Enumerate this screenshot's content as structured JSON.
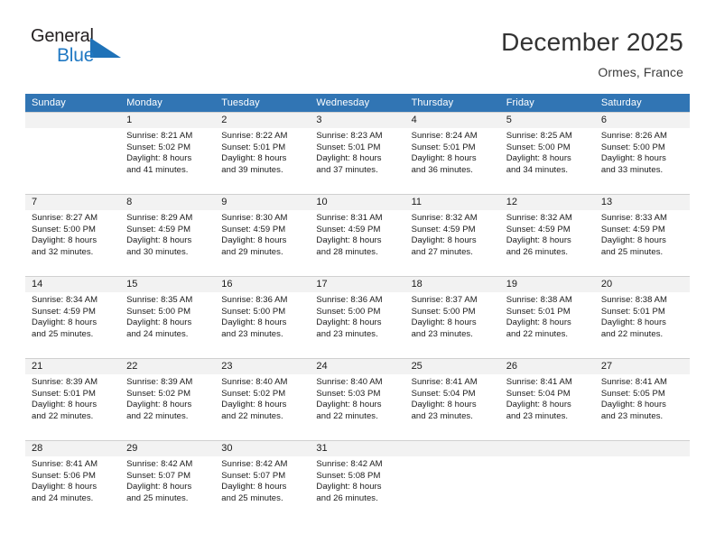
{
  "brand": {
    "name_top": "General",
    "name_bottom": "Blue",
    "triangle_color": "#1f72b8",
    "blue_color": "#2079c3"
  },
  "header": {
    "title": "December 2025",
    "subtitle": "Ormes, France"
  },
  "colors": {
    "header_bar": "#3175b4",
    "daynum_band": "#f2f2f2",
    "grid_line": "#d0d0d0"
  },
  "weekdays": [
    "Sunday",
    "Monday",
    "Tuesday",
    "Wednesday",
    "Thursday",
    "Friday",
    "Saturday"
  ],
  "weeks": [
    [
      {
        "day": "",
        "l1": "",
        "l2": "",
        "l3": "",
        "l4": ""
      },
      {
        "day": "1",
        "l1": "Sunrise: 8:21 AM",
        "l2": "Sunset: 5:02 PM",
        "l3": "Daylight: 8 hours",
        "l4": "and 41 minutes."
      },
      {
        "day": "2",
        "l1": "Sunrise: 8:22 AM",
        "l2": "Sunset: 5:01 PM",
        "l3": "Daylight: 8 hours",
        "l4": "and 39 minutes."
      },
      {
        "day": "3",
        "l1": "Sunrise: 8:23 AM",
        "l2": "Sunset: 5:01 PM",
        "l3": "Daylight: 8 hours",
        "l4": "and 37 minutes."
      },
      {
        "day": "4",
        "l1": "Sunrise: 8:24 AM",
        "l2": "Sunset: 5:01 PM",
        "l3": "Daylight: 8 hours",
        "l4": "and 36 minutes."
      },
      {
        "day": "5",
        "l1": "Sunrise: 8:25 AM",
        "l2": "Sunset: 5:00 PM",
        "l3": "Daylight: 8 hours",
        "l4": "and 34 minutes."
      },
      {
        "day": "6",
        "l1": "Sunrise: 8:26 AM",
        "l2": "Sunset: 5:00 PM",
        "l3": "Daylight: 8 hours",
        "l4": "and 33 minutes."
      }
    ],
    [
      {
        "day": "7",
        "l1": "Sunrise: 8:27 AM",
        "l2": "Sunset: 5:00 PM",
        "l3": "Daylight: 8 hours",
        "l4": "and 32 minutes."
      },
      {
        "day": "8",
        "l1": "Sunrise: 8:29 AM",
        "l2": "Sunset: 4:59 PM",
        "l3": "Daylight: 8 hours",
        "l4": "and 30 minutes."
      },
      {
        "day": "9",
        "l1": "Sunrise: 8:30 AM",
        "l2": "Sunset: 4:59 PM",
        "l3": "Daylight: 8 hours",
        "l4": "and 29 minutes."
      },
      {
        "day": "10",
        "l1": "Sunrise: 8:31 AM",
        "l2": "Sunset: 4:59 PM",
        "l3": "Daylight: 8 hours",
        "l4": "and 28 minutes."
      },
      {
        "day": "11",
        "l1": "Sunrise: 8:32 AM",
        "l2": "Sunset: 4:59 PM",
        "l3": "Daylight: 8 hours",
        "l4": "and 27 minutes."
      },
      {
        "day": "12",
        "l1": "Sunrise: 8:32 AM",
        "l2": "Sunset: 4:59 PM",
        "l3": "Daylight: 8 hours",
        "l4": "and 26 minutes."
      },
      {
        "day": "13",
        "l1": "Sunrise: 8:33 AM",
        "l2": "Sunset: 4:59 PM",
        "l3": "Daylight: 8 hours",
        "l4": "and 25 minutes."
      }
    ],
    [
      {
        "day": "14",
        "l1": "Sunrise: 8:34 AM",
        "l2": "Sunset: 4:59 PM",
        "l3": "Daylight: 8 hours",
        "l4": "and 25 minutes."
      },
      {
        "day": "15",
        "l1": "Sunrise: 8:35 AM",
        "l2": "Sunset: 5:00 PM",
        "l3": "Daylight: 8 hours",
        "l4": "and 24 minutes."
      },
      {
        "day": "16",
        "l1": "Sunrise: 8:36 AM",
        "l2": "Sunset: 5:00 PM",
        "l3": "Daylight: 8 hours",
        "l4": "and 23 minutes."
      },
      {
        "day": "17",
        "l1": "Sunrise: 8:36 AM",
        "l2": "Sunset: 5:00 PM",
        "l3": "Daylight: 8 hours",
        "l4": "and 23 minutes."
      },
      {
        "day": "18",
        "l1": "Sunrise: 8:37 AM",
        "l2": "Sunset: 5:00 PM",
        "l3": "Daylight: 8 hours",
        "l4": "and 23 minutes."
      },
      {
        "day": "19",
        "l1": "Sunrise: 8:38 AM",
        "l2": "Sunset: 5:01 PM",
        "l3": "Daylight: 8 hours",
        "l4": "and 22 minutes."
      },
      {
        "day": "20",
        "l1": "Sunrise: 8:38 AM",
        "l2": "Sunset: 5:01 PM",
        "l3": "Daylight: 8 hours",
        "l4": "and 22 minutes."
      }
    ],
    [
      {
        "day": "21",
        "l1": "Sunrise: 8:39 AM",
        "l2": "Sunset: 5:01 PM",
        "l3": "Daylight: 8 hours",
        "l4": "and 22 minutes."
      },
      {
        "day": "22",
        "l1": "Sunrise: 8:39 AM",
        "l2": "Sunset: 5:02 PM",
        "l3": "Daylight: 8 hours",
        "l4": "and 22 minutes."
      },
      {
        "day": "23",
        "l1": "Sunrise: 8:40 AM",
        "l2": "Sunset: 5:02 PM",
        "l3": "Daylight: 8 hours",
        "l4": "and 22 minutes."
      },
      {
        "day": "24",
        "l1": "Sunrise: 8:40 AM",
        "l2": "Sunset: 5:03 PM",
        "l3": "Daylight: 8 hours",
        "l4": "and 22 minutes."
      },
      {
        "day": "25",
        "l1": "Sunrise: 8:41 AM",
        "l2": "Sunset: 5:04 PM",
        "l3": "Daylight: 8 hours",
        "l4": "and 23 minutes."
      },
      {
        "day": "26",
        "l1": "Sunrise: 8:41 AM",
        "l2": "Sunset: 5:04 PM",
        "l3": "Daylight: 8 hours",
        "l4": "and 23 minutes."
      },
      {
        "day": "27",
        "l1": "Sunrise: 8:41 AM",
        "l2": "Sunset: 5:05 PM",
        "l3": "Daylight: 8 hours",
        "l4": "and 23 minutes."
      }
    ],
    [
      {
        "day": "28",
        "l1": "Sunrise: 8:41 AM",
        "l2": "Sunset: 5:06 PM",
        "l3": "Daylight: 8 hours",
        "l4": "and 24 minutes."
      },
      {
        "day": "29",
        "l1": "Sunrise: 8:42 AM",
        "l2": "Sunset: 5:07 PM",
        "l3": "Daylight: 8 hours",
        "l4": "and 25 minutes."
      },
      {
        "day": "30",
        "l1": "Sunrise: 8:42 AM",
        "l2": "Sunset: 5:07 PM",
        "l3": "Daylight: 8 hours",
        "l4": "and 25 minutes."
      },
      {
        "day": "31",
        "l1": "Sunrise: 8:42 AM",
        "l2": "Sunset: 5:08 PM",
        "l3": "Daylight: 8 hours",
        "l4": "and 26 minutes."
      },
      {
        "day": "",
        "l1": "",
        "l2": "",
        "l3": "",
        "l4": ""
      },
      {
        "day": "",
        "l1": "",
        "l2": "",
        "l3": "",
        "l4": ""
      },
      {
        "day": "",
        "l1": "",
        "l2": "",
        "l3": "",
        "l4": ""
      }
    ]
  ]
}
